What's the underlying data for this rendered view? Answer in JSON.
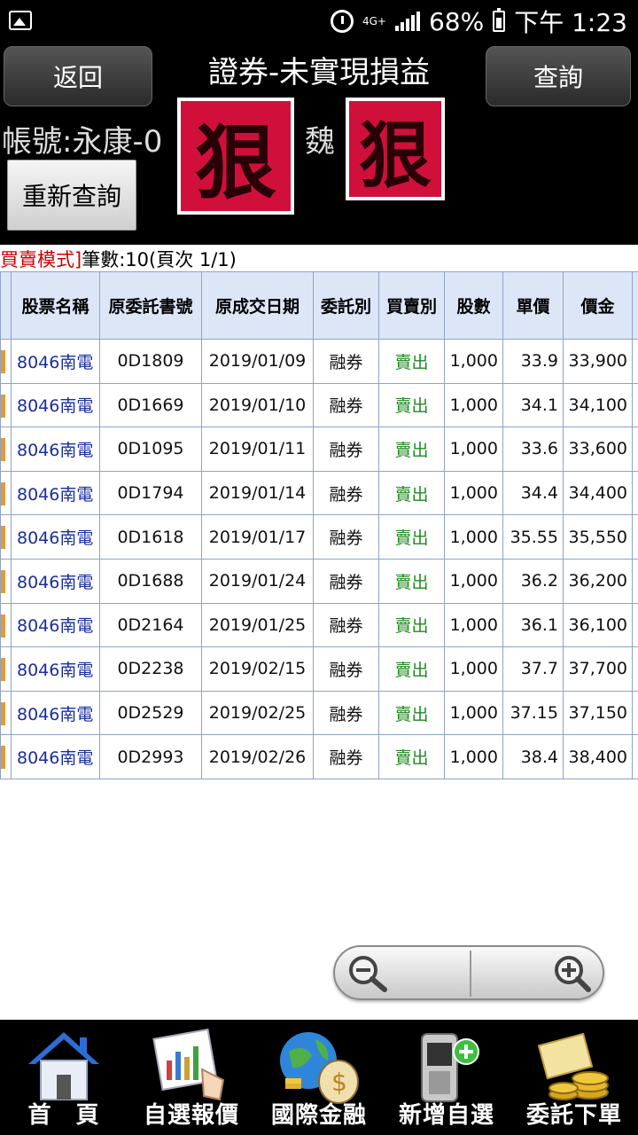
{
  "status_bar": {
    "network": "4G+",
    "battery": "68%",
    "time": "下午 1:23"
  },
  "header": {
    "back_label": "返回",
    "title": "證券-未實現損益",
    "query_label": "查詢",
    "account_label": "帳號:永康-0",
    "account_suffix": "魏",
    "stamp_char": "狠",
    "requery_label": "重新查詢"
  },
  "summary": {
    "mode": "買賣模式]",
    "count_text": "筆數:10(頁次 1/1)"
  },
  "table": {
    "columns": [
      "股票名稱",
      "原委託書號",
      "原成交日期",
      "委託別",
      "買賣別",
      "股數",
      "單價",
      "價金"
    ],
    "rows": [
      {
        "stock": "8046南電",
        "order": "0D1809",
        "date": "2019/01/09",
        "type": "融券",
        "side": "賣出",
        "qty": "1,000",
        "price": "33.9",
        "amount": "33,900"
      },
      {
        "stock": "8046南電",
        "order": "0D1669",
        "date": "2019/01/10",
        "type": "融券",
        "side": "賣出",
        "qty": "1,000",
        "price": "34.1",
        "amount": "34,100"
      },
      {
        "stock": "8046南電",
        "order": "0D1095",
        "date": "2019/01/11",
        "type": "融券",
        "side": "賣出",
        "qty": "1,000",
        "price": "33.6",
        "amount": "33,600"
      },
      {
        "stock": "8046南電",
        "order": "0D1794",
        "date": "2019/01/14",
        "type": "融券",
        "side": "賣出",
        "qty": "1,000",
        "price": "34.4",
        "amount": "34,400"
      },
      {
        "stock": "8046南電",
        "order": "0D1618",
        "date": "2019/01/17",
        "type": "融券",
        "side": "賣出",
        "qty": "1,000",
        "price": "35.55",
        "amount": "35,550"
      },
      {
        "stock": "8046南電",
        "order": "0D1688",
        "date": "2019/01/24",
        "type": "融券",
        "side": "賣出",
        "qty": "1,000",
        "price": "36.2",
        "amount": "36,200"
      },
      {
        "stock": "8046南電",
        "order": "0D2164",
        "date": "2019/01/25",
        "type": "融券",
        "side": "賣出",
        "qty": "1,000",
        "price": "36.1",
        "amount": "36,100"
      },
      {
        "stock": "8046南電",
        "order": "0D2238",
        "date": "2019/02/15",
        "type": "融券",
        "side": "賣出",
        "qty": "1,000",
        "price": "37.7",
        "amount": "37,700"
      },
      {
        "stock": "8046南電",
        "order": "0D2529",
        "date": "2019/02/25",
        "type": "融券",
        "side": "賣出",
        "qty": "1,000",
        "price": "37.15",
        "amount": "37,150"
      },
      {
        "stock": "8046南電",
        "order": "0D2993",
        "date": "2019/02/26",
        "type": "融券",
        "side": "賣出",
        "qty": "1,000",
        "price": "38.4",
        "amount": "38,400"
      }
    ]
  },
  "zoom": {
    "out_icon": "zoom-out-icon",
    "in_icon": "zoom-in-icon"
  },
  "bottom_nav": [
    {
      "label": "首　頁",
      "icon": "home-icon"
    },
    {
      "label": "自選報價",
      "icon": "watchlist-chart-icon"
    },
    {
      "label": "國際金融",
      "icon": "globe-money-icon"
    },
    {
      "label": "新增自選",
      "icon": "phone-add-icon"
    },
    {
      "label": "委託下單",
      "icon": "coins-order-icon"
    }
  ],
  "colors": {
    "stamp_red": "#d0103a",
    "stock_link": "#1a2e9e",
    "sell_green": "#1e8a1e",
    "mode_red": "#cc0000",
    "header_bg": "#dde6f7",
    "row_marker": "#e39a3a"
  }
}
